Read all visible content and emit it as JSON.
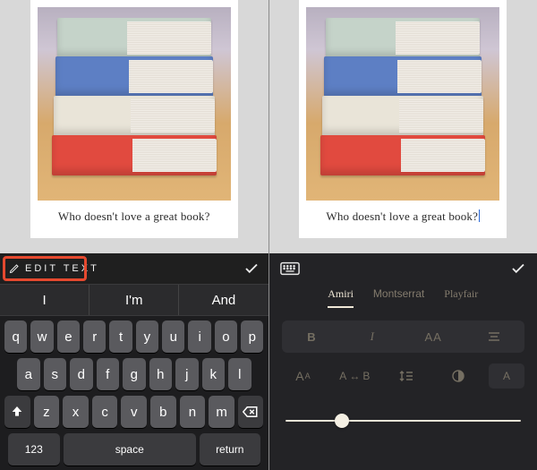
{
  "caption": "Who doesn't love a great book?",
  "left": {
    "topbar": {
      "edit_label": "EDIT TEXT"
    },
    "suggestions": [
      "I",
      "I'm",
      "And"
    ],
    "keyboard": {
      "row1": [
        "q",
        "w",
        "e",
        "r",
        "t",
        "y",
        "u",
        "i",
        "o",
        "p"
      ],
      "row2": [
        "a",
        "s",
        "d",
        "f",
        "g",
        "h",
        "j",
        "k",
        "l"
      ],
      "row3": [
        "z",
        "x",
        "c",
        "v",
        "b",
        "n",
        "m"
      ],
      "numbers_label": "123",
      "space_label": "space",
      "return_label": "return"
    }
  },
  "right": {
    "fonts": [
      {
        "name": "Amiri",
        "active": true
      },
      {
        "name": "Montserrat",
        "active": false
      },
      {
        "name": "Playfair",
        "active": false
      }
    ],
    "style_segments": {
      "bold": "B",
      "italic": "I",
      "caps": "AA"
    },
    "tools": {
      "size": "Aᴀ",
      "tracking": "A ↔ B",
      "leading": "↕≡",
      "color": "◐",
      "bg": "A"
    },
    "slider_value": 0.24
  }
}
